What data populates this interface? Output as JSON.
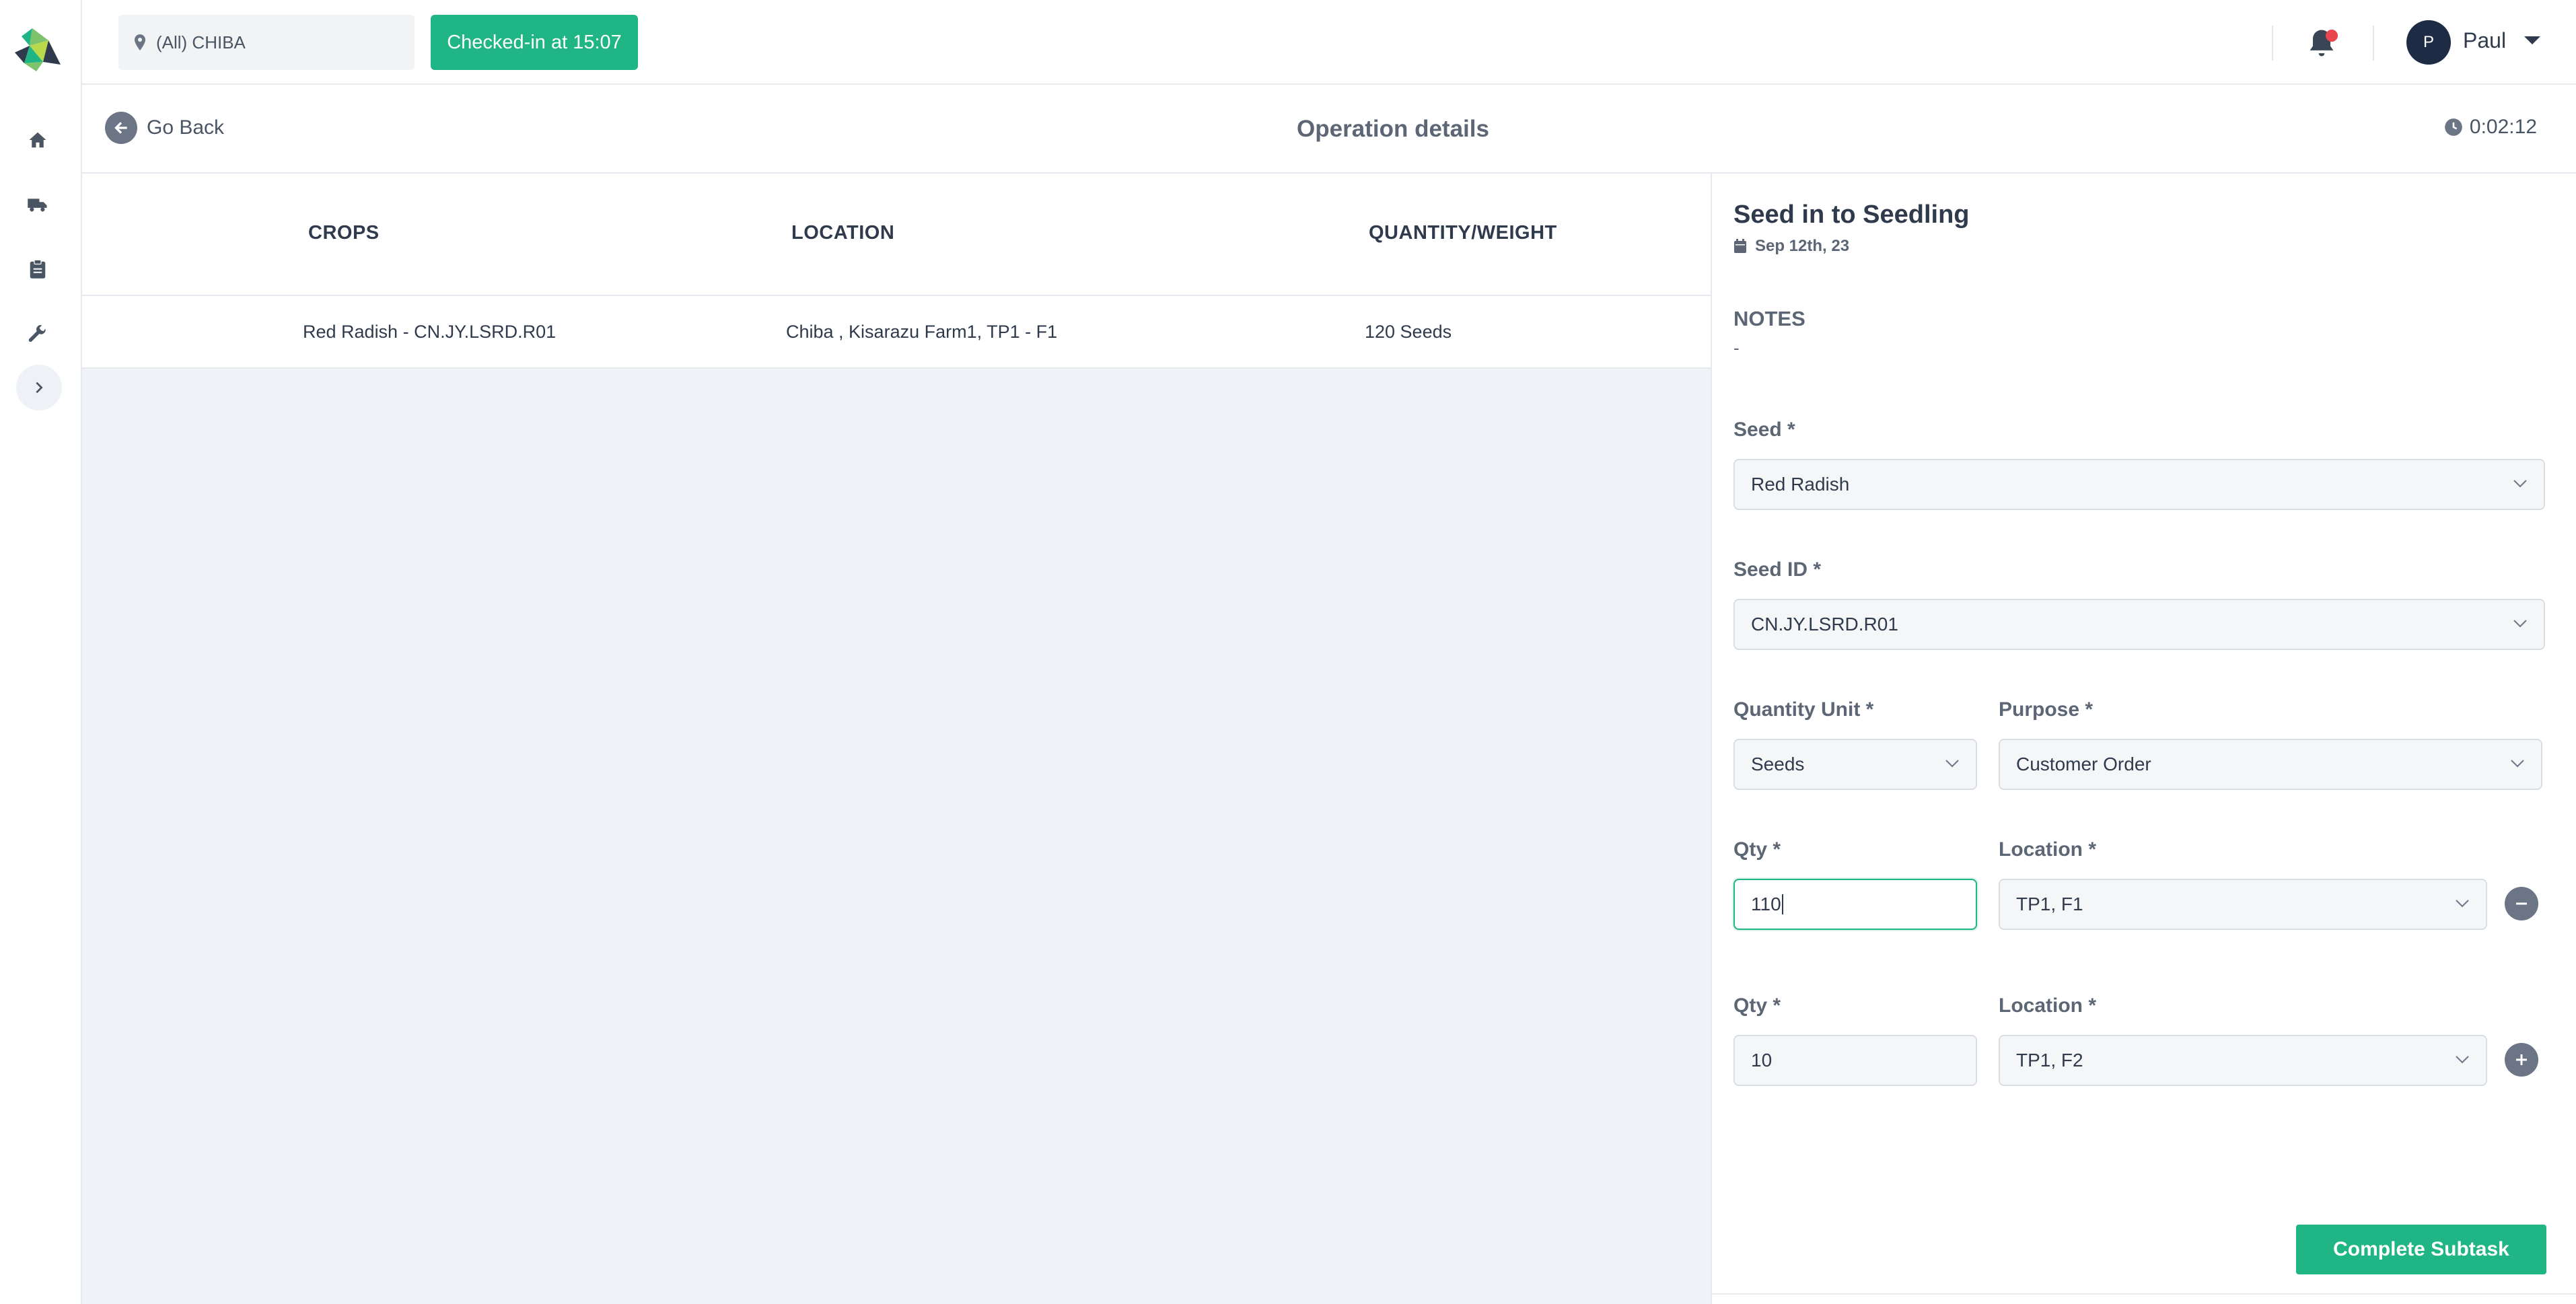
{
  "topbar": {
    "location_filter": "(All) CHIBA",
    "checkin_label": "Checked-in at 15:07",
    "user_initial": "P",
    "user_name": "Paul"
  },
  "header": {
    "back_label": "Go Back",
    "title": "Operation details",
    "timer": "0:02:12"
  },
  "sidebar": {
    "items": [
      {
        "icon": "home-icon"
      },
      {
        "icon": "truck-icon"
      },
      {
        "icon": "clipboard-icon"
      },
      {
        "icon": "wrench-icon"
      },
      {
        "icon": "chevron-right-icon"
      }
    ]
  },
  "table": {
    "columns": [
      "CROPS",
      "LOCATION",
      "QUANTITY/WEIGHT"
    ],
    "rows": [
      {
        "crop": "Red Radish - CN.JY.LSRD.R01",
        "location": "Chiba , Kisarazu Farm1, TP1 - F1",
        "quantity": "120 Seeds"
      }
    ]
  },
  "panel": {
    "title": "Seed in to Seedling",
    "date": "Sep 12th, 23",
    "notes_label": "NOTES",
    "notes_value": "-",
    "seed_label": "Seed *",
    "seed_value": "Red Radish",
    "seed_id_label": "Seed ID *",
    "seed_id_value": "CN.JY.LSRD.R01",
    "quantity_unit_label": "Quantity Unit *",
    "quantity_unit_value": "Seeds",
    "purpose_label": "Purpose *",
    "purpose_value": "Customer Order",
    "allocations": [
      {
        "qty_label": "Qty *",
        "qty_value": "110",
        "location_label": "Location *",
        "location_value": "TP1, F1"
      },
      {
        "qty_label": "Qty *",
        "qty_value": "10",
        "location_label": "Location *",
        "location_value": "TP1, F2"
      }
    ],
    "complete_label": "Complete Subtask"
  },
  "colors": {
    "accent": "#1fb584",
    "notification_dot": "#e8454f",
    "avatar": "#1d2b44"
  }
}
